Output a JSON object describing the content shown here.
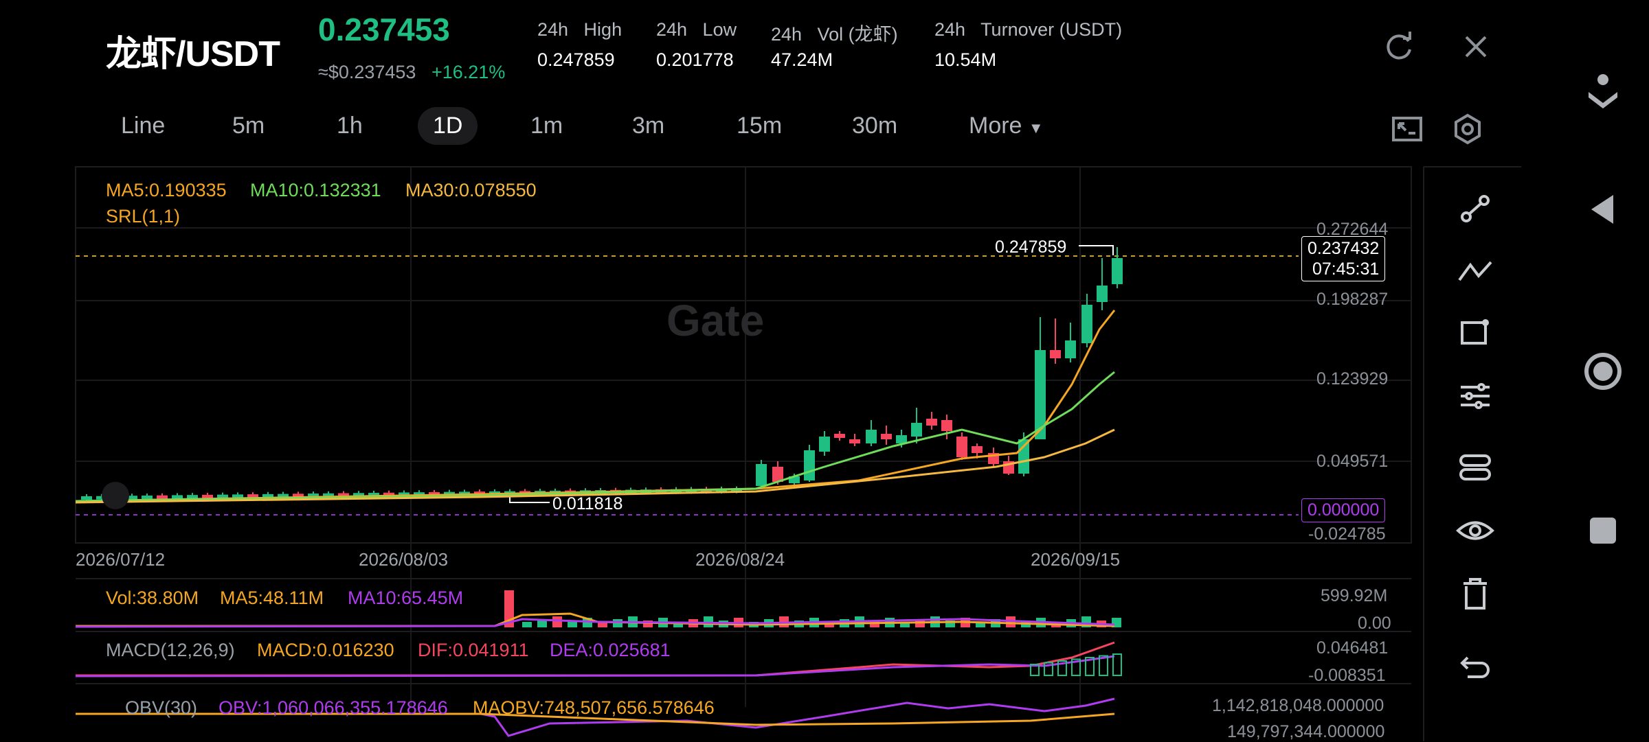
{
  "header": {
    "pair": "龙虾/USDT",
    "last_price": "0.237453",
    "fiat_price": "≈$0.237453",
    "change_pct": "+16.21%",
    "stats": [
      {
        "label": "24h   High",
        "value": "0.247859"
      },
      {
        "label": "24h   Low",
        "value": "0.201778"
      },
      {
        "label": "24h   Vol (龙虾)",
        "value": "47.24M"
      },
      {
        "label": "24h   Turnover (USDT)",
        "value": "10.54M"
      }
    ]
  },
  "timeframes": [
    "Line",
    "5m",
    "1h",
    "1D",
    "1m",
    "3m",
    "15m",
    "30m",
    "More"
  ],
  "active_timeframe": "1D",
  "indicators": {
    "ma5": "MA5:0.190335",
    "ma10": "MA10:0.132331",
    "ma30": "MA30:0.078550",
    "srl": "SRL(1,1)"
  },
  "watermark": "Gate",
  "price_axis": [
    "0.272644",
    "0.198287",
    "0.123929",
    "0.049571",
    "-0.024785"
  ],
  "current_price_tag": {
    "price": "0.237432",
    "countdown": "07:45:31"
  },
  "zero_tag": "0.000000",
  "high_marker": "0.247859",
  "low_marker": "0.011818",
  "dates": [
    "2026/07/12",
    "2026/08/03",
    "2026/08/24",
    "2026/09/15"
  ],
  "volume": {
    "vol": "Vol:38.80M",
    "ma5": "MA5:48.11M",
    "ma10": "MA10:65.45M",
    "axis": [
      "599.92M",
      "0.00"
    ]
  },
  "macd": {
    "title": "MACD(12,26,9)",
    "macd": "MACD:0.016230",
    "dif": "DIF:0.041911",
    "dea": "DEA:0.025681",
    "axis": [
      "0.046481",
      "-0.008351"
    ]
  },
  "obv": {
    "title": "OBV(30)",
    "obv": "OBV:1,060,066,355.178646",
    "maobv": "MAOBV:748,507,656.578646",
    "axis": [
      "1,142,818,048.000000",
      "149,797,344.000000"
    ]
  },
  "colors": {
    "up": "#1fbf84",
    "down": "#f6465d",
    "ma5": "#f5a623",
    "ma10": "#6fdc5a",
    "ma30": "#f5b942",
    "purple": "#b03cf0"
  },
  "icons": [
    "refresh-icon",
    "close-icon",
    "fullscreen-icon",
    "settings-icon",
    "draw-line-icon",
    "trend-tool-icon",
    "shape-tool-icon",
    "adjust-icon",
    "indicator-icon",
    "eye-icon",
    "trash-icon",
    "undo-icon"
  ]
}
